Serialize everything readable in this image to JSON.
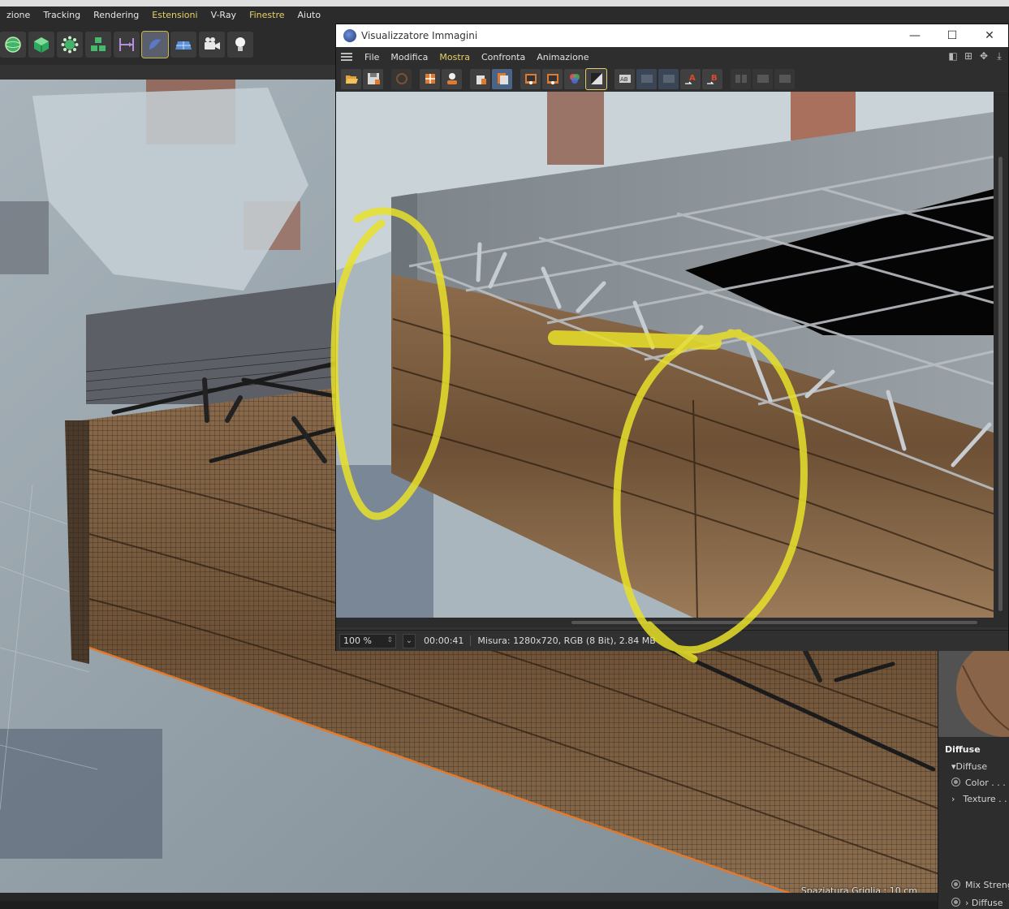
{
  "app": {
    "menu": [
      {
        "label": "zione",
        "highlight": false
      },
      {
        "label": "Tracking",
        "highlight": false
      },
      {
        "label": "Rendering",
        "highlight": false
      },
      {
        "label": "Estensioni",
        "highlight": true
      },
      {
        "label": "V-Ray",
        "highlight": false
      },
      {
        "label": "Finestre",
        "highlight": true
      },
      {
        "label": "Aiuto",
        "highlight": false
      }
    ],
    "toolbar_icons": [
      "sphere-icon",
      "cube-icon",
      "gear-node-icon",
      "cubes-icon",
      "measure-icon",
      "sculpt-icon",
      "floor-icon",
      "camera-icon",
      "light-bulb-icon"
    ]
  },
  "viewport": {
    "grid_label": "Spaziatura Griglia : 10 cm"
  },
  "viewer": {
    "title": "Visualizzatore Immagini",
    "window_controls": {
      "minimize": "—",
      "maximize": "☐",
      "close": "✕"
    },
    "menu": [
      {
        "label": "File",
        "highlight": false
      },
      {
        "label": "Modifica",
        "highlight": false
      },
      {
        "label": "Mostra",
        "highlight": true
      },
      {
        "label": "Confronta",
        "highlight": false
      },
      {
        "label": "Animazione",
        "highlight": false
      }
    ],
    "status": {
      "zoom": "100 %",
      "time": "00:00:41",
      "info": "Misura: 1280x720, RGB (8 Bit), 2.84 MB"
    }
  },
  "attributes": {
    "section": "Diffuse",
    "group": "Diffuse",
    "color_label": "Color . . .",
    "texture_label": "Texture . . .",
    "mix_strength_label": "Mix Streng",
    "diffuse_sub_label": "Diffuse"
  },
  "colors": {
    "accent_yellow": "#e6d26a",
    "annotation_yellow": "#e8e02a",
    "wood": "#7a5a3c",
    "wall": "#b7c2c8",
    "metal": "#8e969c"
  }
}
